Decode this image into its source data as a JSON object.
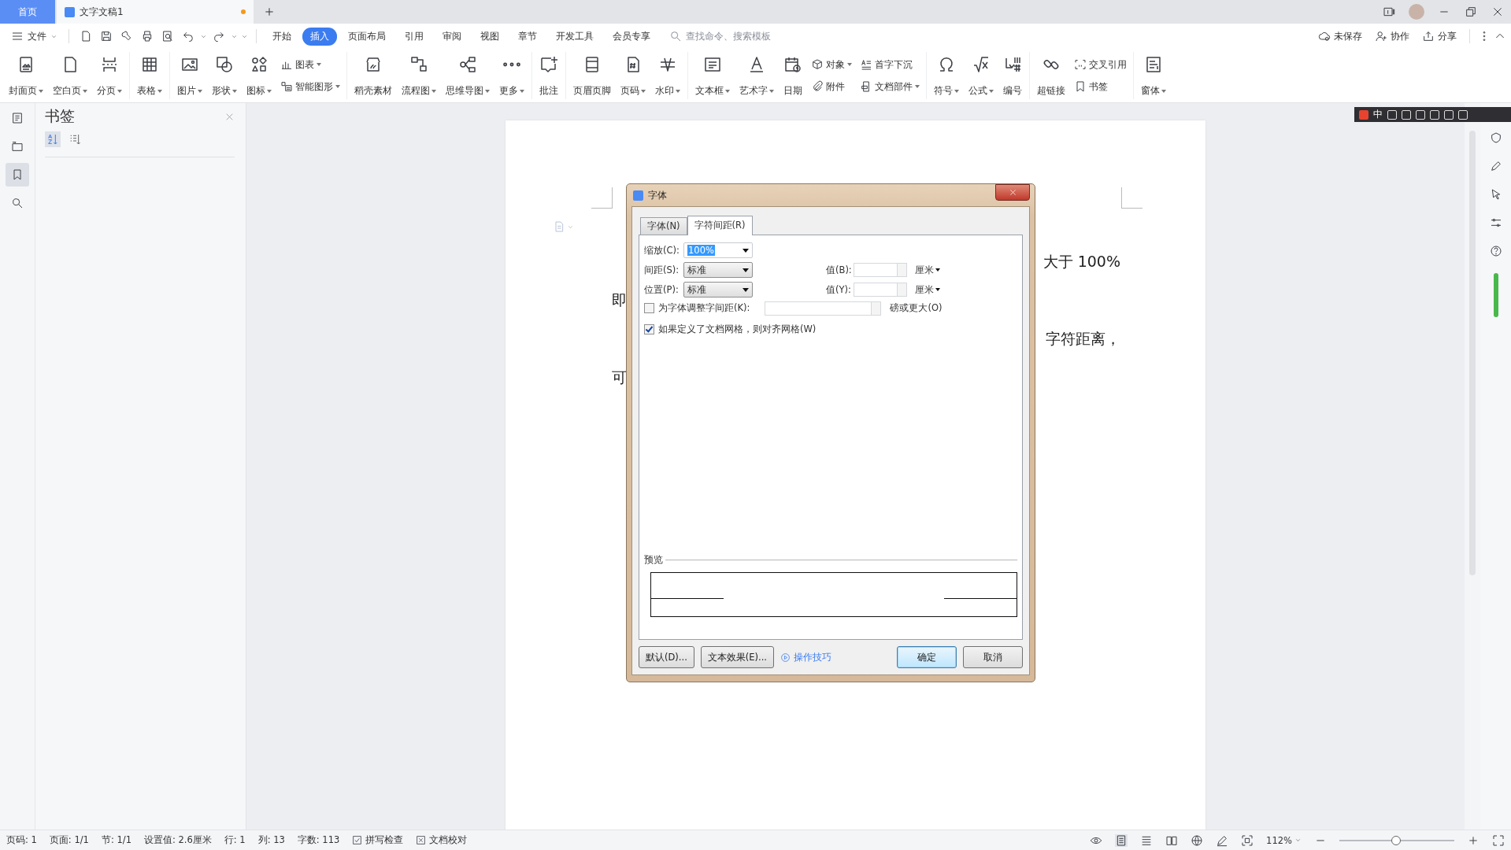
{
  "title_bar": {
    "tabs": [
      {
        "label": "首页",
        "kind": "home",
        "selected": false,
        "modified": false
      },
      {
        "label": "文字文稿1",
        "kind": "document",
        "selected": true,
        "modified": true
      }
    ]
  },
  "menu": {
    "file": "文件",
    "tabs": [
      {
        "label": "开始",
        "selected": false
      },
      {
        "label": "插入",
        "selected": true
      },
      {
        "label": "页面布局",
        "selected": false
      },
      {
        "label": "引用",
        "selected": false
      },
      {
        "label": "审阅",
        "selected": false
      },
      {
        "label": "视图",
        "selected": false
      },
      {
        "label": "章节",
        "selected": false
      },
      {
        "label": "开发工具",
        "selected": false
      },
      {
        "label": "会员专享",
        "selected": false
      }
    ],
    "search": {
      "placeholder": "查找命令、搜索模板"
    },
    "actions": [
      "未保存",
      "协作",
      "分享"
    ]
  },
  "ribbon": [
    {
      "items": [
        {
          "kind": "large",
          "label": "封面页",
          "dropdown": true
        },
        {
          "kind": "large",
          "label": "空白页",
          "dropdown": true
        },
        {
          "kind": "large",
          "label": "分页",
          "dropdown": true
        }
      ]
    },
    {
      "items": [
        {
          "kind": "large",
          "label": "表格",
          "dropdown": true
        }
      ]
    },
    {
      "items": [
        {
          "kind": "large",
          "label": "图片",
          "dropdown": true
        },
        {
          "kind": "large",
          "label": "形状",
          "dropdown": true
        },
        {
          "kind": "large",
          "label": "图标",
          "dropdown": true
        },
        {
          "kind": "stack",
          "items": [
            {
              "label": "图表",
              "dropdown": true
            },
            {
              "label": "智能图形",
              "dropdown": true
            }
          ]
        }
      ]
    },
    {
      "items": [
        {
          "kind": "large",
          "label": "稻壳素材",
          "dropdown": false
        },
        {
          "kind": "large",
          "label": "流程图",
          "dropdown": true
        },
        {
          "kind": "large",
          "label": "思维导图",
          "dropdown": true
        },
        {
          "kind": "large",
          "label": "更多",
          "dropdown": true
        }
      ]
    },
    {
      "items": [
        {
          "kind": "large",
          "label": "批注",
          "dropdown": false
        }
      ]
    },
    {
      "items": [
        {
          "kind": "large",
          "label": "页眉页脚",
          "dropdown": false
        },
        {
          "kind": "large",
          "label": "页码",
          "dropdown": true
        },
        {
          "kind": "large",
          "label": "水印",
          "dropdown": true
        }
      ]
    },
    {
      "items": [
        {
          "kind": "large",
          "label": "文本框",
          "dropdown": true
        },
        {
          "kind": "large",
          "label": "艺术字",
          "dropdown": true
        },
        {
          "kind": "large",
          "label": "日期",
          "dropdown": false
        },
        {
          "kind": "stack",
          "items": [
            {
              "label": "对象",
              "dropdown": true
            },
            {
              "label": "附件",
              "dropdown": false
            }
          ]
        },
        {
          "kind": "stack",
          "items": [
            {
              "label": "首字下沉",
              "dropdown": false
            },
            {
              "label": "文档部件",
              "dropdown": true
            }
          ]
        }
      ]
    },
    {
      "items": [
        {
          "kind": "large",
          "label": "符号",
          "dropdown": true
        },
        {
          "kind": "large",
          "label": "公式",
          "dropdown": true
        },
        {
          "kind": "large",
          "label": "编号",
          "dropdown": false
        }
      ]
    },
    {
      "items": [
        {
          "kind": "large",
          "label": "超链接",
          "dropdown": false
        },
        {
          "kind": "stack",
          "items": [
            {
              "label": "交叉引用",
              "dropdown": false
            },
            {
              "label": "书签",
              "dropdown": false
            }
          ]
        }
      ]
    },
    {
      "items": [
        {
          "kind": "large",
          "label": "窗体",
          "dropdown": true
        }
      ]
    }
  ],
  "nav_rail": [
    {
      "selected": false
    },
    {
      "selected": false
    },
    {
      "selected": true
    },
    {
      "selected": false
    }
  ],
  "bookmark_panel": {
    "title": "书签",
    "sort_buttons": [
      {
        "selected": true
      },
      {
        "selected": false
      }
    ]
  },
  "document": {
    "lines": [
      {
        "kind": "right",
        "text": "大于 100%"
      },
      {
        "kind": "left",
        "text": "即"
      },
      {
        "kind": "right",
        "text": "字符距离，"
      },
      {
        "kind": "left",
        "text": "可"
      }
    ]
  },
  "dialog": {
    "title": "字体",
    "tabs": [
      {
        "label": "字体(N)",
        "selected": false
      },
      {
        "label": "字符间距(R)",
        "selected": true
      }
    ],
    "scale": {
      "label": "缩放(C):",
      "value": "100%"
    },
    "rows": [
      {
        "label": "间距(S):",
        "value": "标准",
        "value_label": "值(B):",
        "unit": "厘米"
      },
      {
        "label": "位置(P):",
        "value": "标准",
        "value_label": "值(Y):",
        "unit": "厘米"
      }
    ],
    "options": [
      {
        "label": "为字体调整字间距(K):",
        "checked": false,
        "suffix": "磅或更大(O)"
      },
      {
        "label": "如果定义了文档网格，则对齐网格(W)",
        "checked": true
      }
    ],
    "preview": {
      "label": "预览"
    },
    "buttons": [
      {
        "kind": "button",
        "label": "默认(D)...",
        "default": false
      },
      {
        "kind": "button",
        "label": "文本效果(E)...",
        "default": false
      },
      {
        "kind": "link",
        "label": "操作技巧"
      },
      {
        "kind": "button",
        "label": "确定",
        "default": true
      },
      {
        "kind": "button",
        "label": "取消",
        "default": false
      }
    ]
  },
  "ime_toolbar": {
    "mode": "中"
  },
  "status_bar": {
    "items": [
      "页码: 1",
      "页面: 1/1",
      "节: 1/1",
      "设置值: 2.6厘米",
      "行: 1",
      "列: 13",
      "字数: 113"
    ],
    "tools": [
      {
        "kind": "check",
        "label": "拼写检查"
      },
      {
        "kind": "cross",
        "label": "文档校对"
      }
    ],
    "zoom": {
      "value": "112%",
      "level": 0.49
    }
  }
}
